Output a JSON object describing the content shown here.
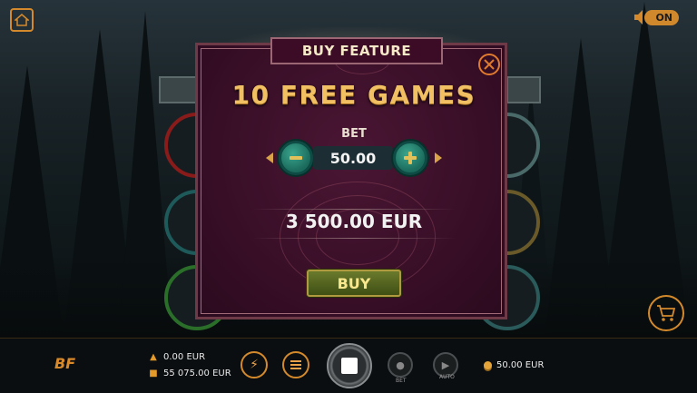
{
  "sound": {
    "label": "ON"
  },
  "modal": {
    "title": "BUY FEATURE",
    "feature": "10 FREE GAMES",
    "bet_label": "BET",
    "bet_value": "50.00",
    "price": "3 500.00 EUR",
    "buy_label": "BUY"
  },
  "bottom": {
    "logo": "BF",
    "win": "0.00 EUR",
    "balance": "55 075.00 EUR",
    "bet_button_label": "BET",
    "auto_label": "AUTO",
    "bet": "50.00 EUR"
  },
  "colors": {
    "accent": "#d48a2c",
    "modal_bg": "#3a0f28",
    "title_gold": "#f0c062",
    "buy_green": "#4f5f1c"
  }
}
